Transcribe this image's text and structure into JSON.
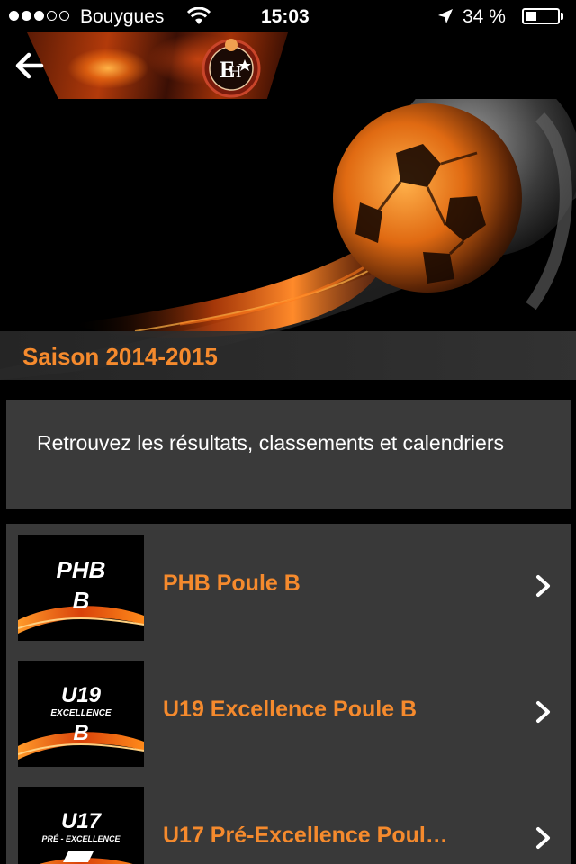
{
  "status_bar": {
    "carrier": "Bouygues",
    "time": "15:03",
    "battery_percent": "34 %",
    "battery_level": 0.34,
    "signal_bars_filled": 3,
    "signal_bars_total": 5
  },
  "header": {
    "back_icon": "arrow-left-icon",
    "logo": "club-crest-logo"
  },
  "hero": {
    "title": "Saison 2014-2015"
  },
  "intro": {
    "text": "Retrouvez les résultats, classements et calendriers"
  },
  "list": {
    "items": [
      {
        "label": "PHB Poule B",
        "thumb_line1": "PHB",
        "thumb_line2": "",
        "thumb_line3": "B"
      },
      {
        "label": "U19 Excellence Poule B",
        "thumb_line1": "U19",
        "thumb_line2": "EXCELLENCE",
        "thumb_line3": "B"
      },
      {
        "label": "U17 Pré-Excellence Poul…",
        "thumb_line1": "U17",
        "thumb_line2": "PRÉ - EXCELLENCE",
        "thumb_line3": ""
      }
    ]
  },
  "colors": {
    "accent": "#f58a2d",
    "panel": "#3a3a3a",
    "background": "#000000"
  }
}
